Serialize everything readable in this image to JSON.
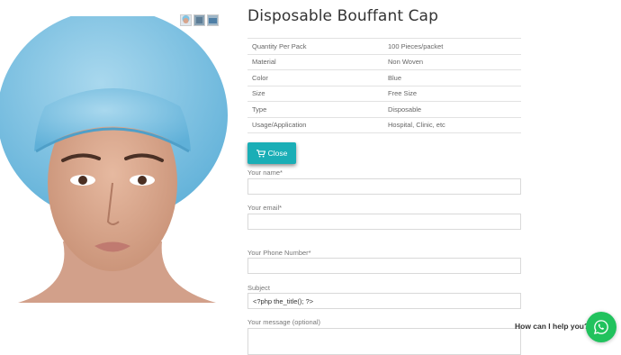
{
  "product": {
    "title": "Disposable Bouffant Cap",
    "specs": [
      {
        "key": "Quantity Per Pack",
        "value": "100 Pieces/packet"
      },
      {
        "key": "Material",
        "value": "Non Woven"
      },
      {
        "key": "Color",
        "value": "Blue"
      },
      {
        "key": "Size",
        "value": "Free Size"
      },
      {
        "key": "Type",
        "value": "Disposable"
      },
      {
        "key": "Usage/Application",
        "value": "Hospital, Clinic, etc"
      }
    ]
  },
  "actions": {
    "close_label": "Close",
    "close_icon": "cart-icon"
  },
  "form": {
    "name_label": "Your name*",
    "name_value": "",
    "email_label": "Your email*",
    "email_value": "",
    "phone_label": "Your Phone Number*",
    "phone_value": "",
    "subject_label": "Subject",
    "subject_value": "<?php the_title(); ?>",
    "message_label": "Your message (optional)"
  },
  "chat": {
    "help_text": "How can I help you?",
    "icon": "whatsapp-icon"
  },
  "colors": {
    "accent": "#1aaeb6",
    "whatsapp": "#21c25d",
    "cap": "#7fc3e3"
  }
}
